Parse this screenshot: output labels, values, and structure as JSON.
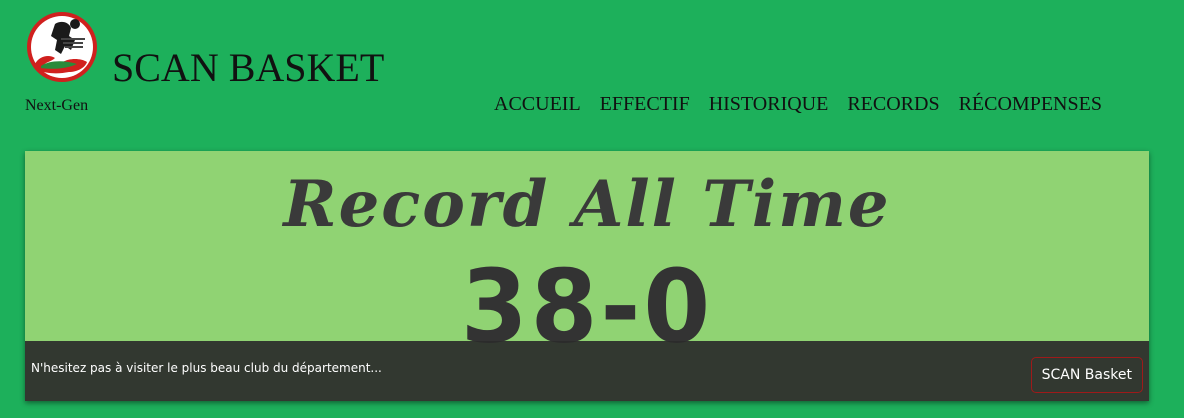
{
  "header": {
    "logo_icon": "scan-club-logo-icon",
    "title": "SCAN BASKET",
    "tagline": "Next-Gen"
  },
  "nav": {
    "items": [
      {
        "label": "ACCUEIL"
      },
      {
        "label": "EFFECTIF"
      },
      {
        "label": "HISTORIQUE"
      },
      {
        "label": "RECORDS"
      },
      {
        "label": "RÉCOMPENSES"
      }
    ]
  },
  "banner": {
    "heading": "Record All Time",
    "score": "38-0",
    "caption": "N'hesitez pas à visiter le plus beau club du département...",
    "button_label": "SCAN Basket"
  },
  "colors": {
    "page_background": "#1db05b",
    "banner_background": "#90d373",
    "caption_background": "#2a2a2a",
    "button_border": "#9e1a1a",
    "logo_red": "#d0201e"
  }
}
